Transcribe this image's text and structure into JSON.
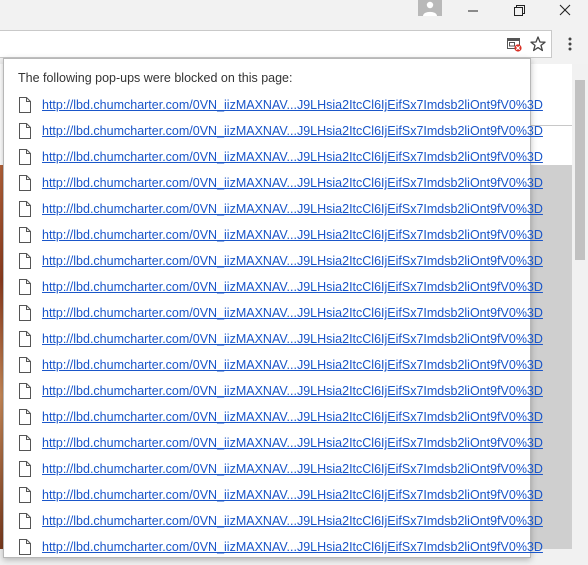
{
  "browser": {
    "window_controls": {
      "profile_icon": "person-icon",
      "minimize_icon": "minimize-icon",
      "maximize_icon": "restore-icon",
      "close_icon": "close-icon"
    },
    "toolbar": {
      "popup_blocked_icon": "popup-blocked-icon",
      "bookmark_icon": "star-icon",
      "menu_icon": "more-vert-icon"
    }
  },
  "popup_blocker": {
    "title": "The following pop-ups were blocked on this page:",
    "item_icon": "page-icon",
    "links": [
      "http://lbd.chumcharter.com/0VN_iizMAXNAV...J9LHsia2ItcCl6IjEifSx7Imdsb2liOnt9fV0%3D",
      "http://lbd.chumcharter.com/0VN_iizMAXNAV...J9LHsia2ItcCl6IjEifSx7Imdsb2liOnt9fV0%3D",
      "http://lbd.chumcharter.com/0VN_iizMAXNAV...J9LHsia2ItcCl6IjEifSx7Imdsb2liOnt9fV0%3D",
      "http://lbd.chumcharter.com/0VN_iizMAXNAV...J9LHsia2ItcCl6IjEifSx7Imdsb2liOnt9fV0%3D",
      "http://lbd.chumcharter.com/0VN_iizMAXNAV...J9LHsia2ItcCl6IjEifSx7Imdsb2liOnt9fV0%3D",
      "http://lbd.chumcharter.com/0VN_iizMAXNAV...J9LHsia2ItcCl6IjEifSx7Imdsb2liOnt9fV0%3D",
      "http://lbd.chumcharter.com/0VN_iizMAXNAV...J9LHsia2ItcCl6IjEifSx7Imdsb2liOnt9fV0%3D",
      "http://lbd.chumcharter.com/0VN_iizMAXNAV...J9LHsia2ItcCl6IjEifSx7Imdsb2liOnt9fV0%3D",
      "http://lbd.chumcharter.com/0VN_iizMAXNAV...J9LHsia2ItcCl6IjEifSx7Imdsb2liOnt9fV0%3D",
      "http://lbd.chumcharter.com/0VN_iizMAXNAV...J9LHsia2ItcCl6IjEifSx7Imdsb2liOnt9fV0%3D",
      "http://lbd.chumcharter.com/0VN_iizMAXNAV...J9LHsia2ItcCl6IjEifSx7Imdsb2liOnt9fV0%3D",
      "http://lbd.chumcharter.com/0VN_iizMAXNAV...J9LHsia2ItcCl6IjEifSx7Imdsb2liOnt9fV0%3D",
      "http://lbd.chumcharter.com/0VN_iizMAXNAV...J9LHsia2ItcCl6IjEifSx7Imdsb2liOnt9fV0%3D",
      "http://lbd.chumcharter.com/0VN_iizMAXNAV...J9LHsia2ItcCl6IjEifSx7Imdsb2liOnt9fV0%3D",
      "http://lbd.chumcharter.com/0VN_iizMAXNAV...J9LHsia2ItcCl6IjEifSx7Imdsb2liOnt9fV0%3D",
      "http://lbd.chumcharter.com/0VN_iizMAXNAV...J9LHsia2ItcCl6IjEifSx7Imdsb2liOnt9fV0%3D",
      "http://lbd.chumcharter.com/0VN_iizMAXNAV...J9LHsia2ItcCl6IjEifSx7Imdsb2liOnt9fV0%3D",
      "http://lbd.chumcharter.com/0VN_iizMAXNAV...J9LHsia2ItcCl6IjEifSx7Imdsb2liOnt9fV0%3D"
    ]
  },
  "colors": {
    "link": "#1a56c9",
    "title_text": "#333333",
    "popup_bg": "#ffffff",
    "chrome_bg": "#f2f2f2"
  }
}
